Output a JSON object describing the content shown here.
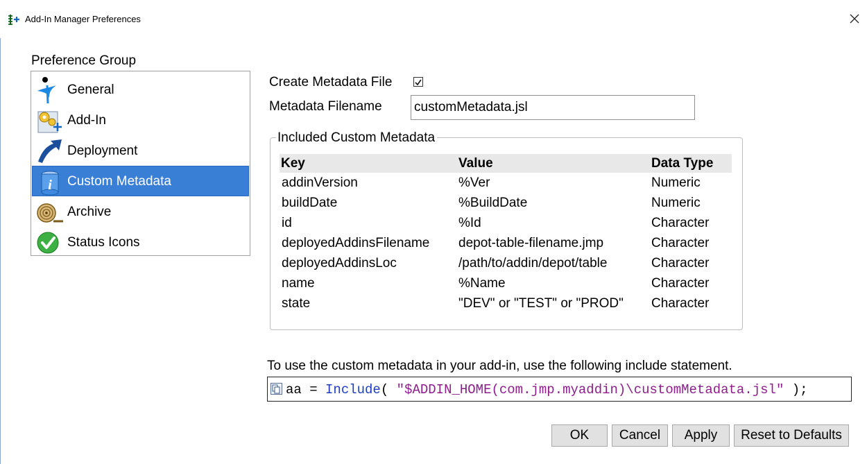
{
  "window": {
    "title": "Add-In Manager Preferences",
    "icon": "add-in-manager-icon",
    "close_icon": "close-icon"
  },
  "preference_group": {
    "label": "Preference Group",
    "selected": "Custom Metadata",
    "selection_color": "#3a7fd6",
    "items": [
      {
        "label": "General",
        "icon": "general-icon"
      },
      {
        "label": "Add-In",
        "icon": "add-in-gear-icon"
      },
      {
        "label": "Deployment",
        "icon": "deployment-arrow-icon"
      },
      {
        "label": "Custom Metadata",
        "icon": "info-icon"
      },
      {
        "label": "Archive",
        "icon": "archive-roll-icon"
      },
      {
        "label": "Status Icons",
        "icon": "green-check-icon"
      }
    ]
  },
  "settings": {
    "create_metadata_label": "Create Metadata File",
    "create_metadata_checked": true,
    "filename_label": "Metadata Filename",
    "filename_value": "customMetadata.jsl"
  },
  "metadata_table": {
    "legend": "Included Custom Metadata",
    "headers": [
      "Key",
      "Value",
      "Data Type"
    ],
    "rows": [
      [
        "addinVersion",
        "%Ver",
        "Numeric"
      ],
      [
        "buildDate",
        "%BuildDate",
        "Numeric"
      ],
      [
        "id",
        "%Id",
        "Character"
      ],
      [
        "deployedAddinsFilename",
        "depot-table-filename.jmp",
        "Character"
      ],
      [
        "deployedAddinsLoc",
        "/path/to/addin/depot/table",
        "Character"
      ],
      [
        "name",
        "%Name",
        "Character"
      ],
      [
        "state",
        "\"DEV\" or \"TEST\" or \"PROD\"",
        "Character"
      ]
    ]
  },
  "include": {
    "hint": "To use the custom metadata in your add-in, use the following include statement.",
    "copy_icon": "copy-icon",
    "code_var": "aa = ",
    "code_fn": "Include",
    "code_paren_open": "( ",
    "code_string": "\"$ADDIN_HOME(com.jmp.myaddin)\\customMetadata.jsl\"",
    "code_tail": " );"
  },
  "buttons": {
    "ok": "OK",
    "cancel": "Cancel",
    "apply": "Apply",
    "reset": "Reset to Defaults"
  }
}
